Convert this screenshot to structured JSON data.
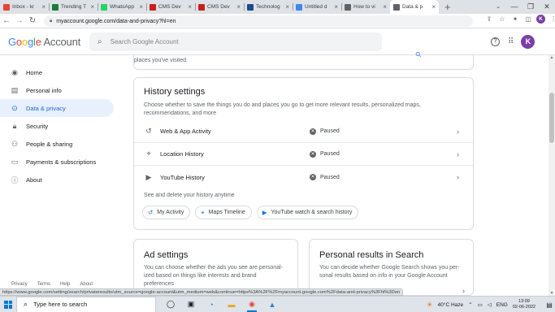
{
  "browser": {
    "tabs": [
      {
        "title": "Inbox - kr",
        "favicon": "gmail-icon",
        "color": "#ea4335"
      },
      {
        "title": "Trending T",
        "favicon": "sheets-icon",
        "color": "#188038"
      },
      {
        "title": "WhatsApp",
        "favicon": "whatsapp-icon",
        "color": "#25d366"
      },
      {
        "title": "CMS Dev",
        "favicon": "cms-icon",
        "color": "#c5221f"
      },
      {
        "title": "CMS Dev",
        "favicon": "cms-icon",
        "color": "#c5221f"
      },
      {
        "title": "Technolog",
        "favicon": "toi-icon",
        "color": "#1a4b8c"
      },
      {
        "title": "Untitled d",
        "favicon": "docs-icon",
        "color": "#4285f4"
      },
      {
        "title": "How to vi",
        "favicon": "google-icon",
        "color": "#5f6368"
      },
      {
        "title": "Data & p",
        "favicon": "google-icon",
        "color": "#5f6368",
        "active": true
      }
    ],
    "new_tab": "+",
    "url": "myaccount.google.com/data-and-privacy?hl=en"
  },
  "header": {
    "logo_google": "Google",
    "logo_account": "Account",
    "search_placeholder": "Search Google Account",
    "avatar_letter": "K",
    "avatar_color": "#7b3fa5"
  },
  "sidebar": {
    "items": [
      {
        "label": "Home",
        "icon": "person-circle-icon",
        "glyph": "◉"
      },
      {
        "label": "Personal info",
        "icon": "id-card-icon",
        "glyph": "▤"
      },
      {
        "label": "Data & privacy",
        "icon": "toggle-icon",
        "glyph": "⊙",
        "active": true
      },
      {
        "label": "Security",
        "icon": "lock-icon",
        "glyph": "🔒︎"
      },
      {
        "label": "People & sharing",
        "icon": "people-icon",
        "glyph": "⚇"
      },
      {
        "label": "Payments & subscriptions",
        "icon": "credit-card-icon",
        "glyph": "▭"
      },
      {
        "label": "About",
        "icon": "info-icon",
        "glyph": "ⓘ"
      }
    ]
  },
  "main": {
    "top_fragment": "places you've visited.",
    "history": {
      "title": "History settings",
      "description": "Choose whether to save the things you do and places you go to get more relevant results, personalized maps, recommendations, and more",
      "rows": [
        {
          "label": "Web & App Activity",
          "status": "Paused",
          "icon": "history-icon",
          "glyph": "↺"
        },
        {
          "label": "Location History",
          "status": "Paused",
          "icon": "location-pin-icon",
          "glyph": "⌖"
        },
        {
          "label": "YouTube History",
          "status": "Paused",
          "icon": "youtube-icon",
          "glyph": "▶"
        }
      ],
      "see_all": "See and delete your history anytime",
      "chips": [
        {
          "label": "My Activity",
          "icon": "my-activity-icon",
          "glyph": "↺"
        },
        {
          "label": "Maps Timeline",
          "icon": "maps-pin-icon",
          "glyph": "⌖"
        },
        {
          "label": "YouTube watch & search history",
          "icon": "youtube-icon",
          "glyph": "▶"
        }
      ]
    },
    "ad_settings": {
      "title": "Ad settings",
      "description_lines": [
        "You can choose whether the ads you see are personal-",
        "ized based on things like interests and brand",
        "preferences"
      ]
    },
    "personal_results": {
      "title": "Personal results in Search",
      "description_lines": [
        "You can decide whether Google Search shows you per-",
        "sonal results based on info in your Google Account"
      ]
    },
    "footer_links": [
      "Privacy",
      "Terms",
      "Help",
      "About"
    ]
  },
  "status_url": "https://www.google.com/setting/search/privateresults/utm_source=google-account&utm_medium=web&continue=https%3A%2F%2Fmyaccount.google.com%2Fdata-and-privacy%3Fhl%3Den",
  "taskbar": {
    "search_placeholder": "Type here to search",
    "weather": "40°C  Haze",
    "language": "ENG",
    "time": "13:09",
    "date": "02-06-2022"
  }
}
